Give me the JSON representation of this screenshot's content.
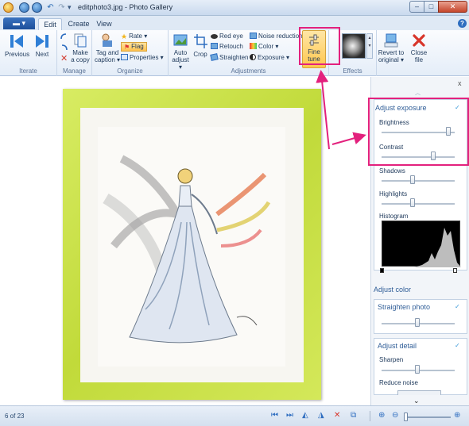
{
  "window": {
    "title": "editphoto3.jpg - Photo Gallery"
  },
  "tabs": {
    "file": "▬ ▾",
    "edit": "Edit",
    "create": "Create",
    "view": "View"
  },
  "ribbon": {
    "iterate": {
      "label": "Iterate",
      "previous": "Previous",
      "next": "Next"
    },
    "manage": {
      "label": "Manage",
      "make_copy_1": "Make",
      "make_copy_2": "a copy"
    },
    "organize": {
      "label": "Organize",
      "tag_1": "Tag and",
      "tag_2": "caption ▾",
      "rate": "Rate ▾",
      "flag": "Flag",
      "properties": "Properties ▾"
    },
    "adjustments": {
      "label": "Adjustments",
      "auto_1": "Auto",
      "auto_2": "adjust ▾",
      "crop": "Crop",
      "red_eye": "Red eye",
      "retouch": "Retouch",
      "straighten": "Straighten",
      "noise": "Noise reduction",
      "color": "Color ▾",
      "exposure": "Exposure ▾",
      "fine_tune_1": "Fine",
      "fine_tune_2": "tune"
    },
    "effects": {
      "label": "Effects"
    },
    "revert_1": "Revert to",
    "revert_2": "original ▾",
    "close_1": "Close",
    "close_2": "file"
  },
  "panel": {
    "close": "x",
    "adjust_exposure": {
      "title": "Adjust exposure",
      "brightness": "Brightness",
      "contrast": "Contrast",
      "shadows": "Shadows",
      "highlights": "Highlights",
      "histogram": "Histogram"
    },
    "adjust_color": "Adjust color",
    "straighten": "Straighten photo",
    "adjust_detail": {
      "title": "Adjust detail",
      "sharpen": "Sharpen",
      "reduce_noise": "Reduce noise"
    },
    "slider_values": {
      "brightness": 0.92,
      "contrast": 0.72,
      "shadows": 0.44,
      "highlights": 0.44,
      "straighten": 0.5,
      "sharpen": 0.5
    }
  },
  "status": {
    "count": "6 of 23"
  },
  "colors": {
    "highlight": "#e3217d",
    "frame": "#c8df42",
    "accent": "#2f6ec0"
  }
}
